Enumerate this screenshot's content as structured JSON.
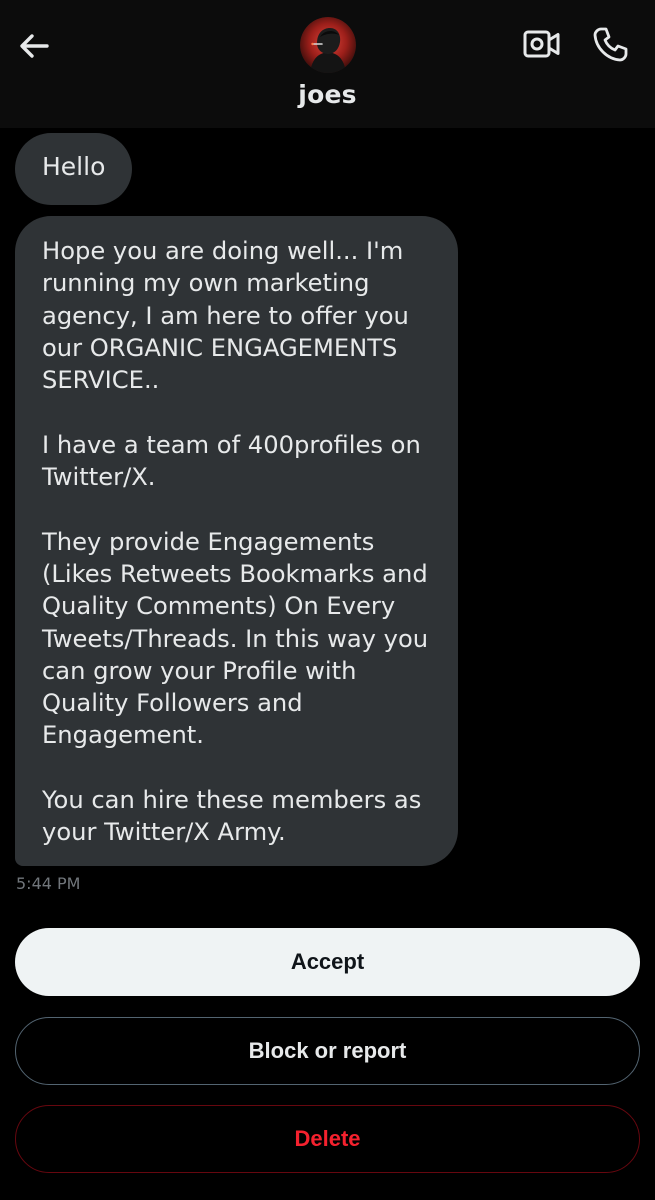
{
  "header": {
    "back_icon": "arrow-left-icon",
    "avatar_icon": "user-avatar",
    "username": "joes",
    "video_icon": "video-camera-icon",
    "phone_icon": "phone-icon"
  },
  "messages": [
    {
      "text": "Hello"
    },
    {
      "text": "Hope you are doing well... I'm running my own marketing agency, I am here to offer you our ORGANIC ENGAGEMENTS SERVICE..\n\nI have a team of 400profiles on Twitter/X.\n\nThey provide Engagements (Likes Retweets Bookmarks and Quality Comments) On Every Tweets/Threads. In this way you can grow your Profile with Quality Followers and Engagement.\n\nYou can hire these members as your Twitter/X Army."
    }
  ],
  "timestamp": "5:44 PM",
  "actions": {
    "accept_label": "Accept",
    "block_label": "Block or report",
    "delete_label": "Delete"
  },
  "colors": {
    "background": "#000000",
    "header": "#0c0c0c",
    "bubble": "#2f3336",
    "text": "#e7e9ea",
    "muted": "#71767b",
    "accept_bg": "#eff3f4",
    "delete_red": "#f4212e"
  }
}
